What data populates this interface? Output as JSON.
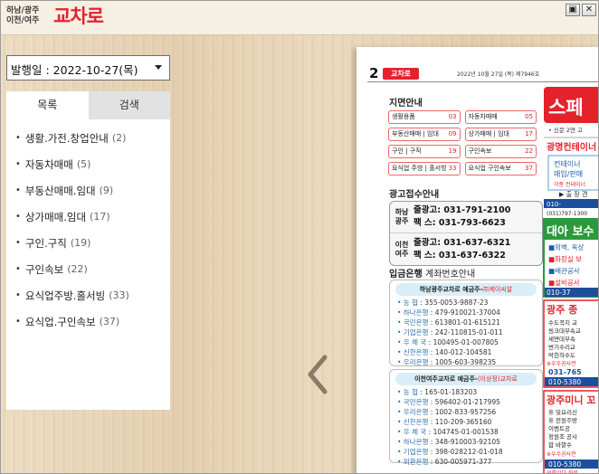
{
  "logo": {
    "region": "하남/광주\n이천/여주",
    "brand": "교차로"
  },
  "window": {
    "buttons": [
      "▣",
      "✕"
    ]
  },
  "date_select": {
    "label": "발행일 : 2022-10-27(목)"
  },
  "left_panel": {
    "tabs": [
      {
        "label": "목록"
      },
      {
        "label": "검색"
      }
    ],
    "categories": [
      {
        "name": "생활.가전.창업안내",
        "count": "(2)"
      },
      {
        "name": "자동차매매",
        "count": "(5)"
      },
      {
        "name": "부동산매매.임대",
        "count": "(9)"
      },
      {
        "name": "상가매매.임대",
        "count": "(17)"
      },
      {
        "name": "구인.구직",
        "count": "(19)"
      },
      {
        "name": "구인속보",
        "count": "(22)"
      },
      {
        "name": "요식업주방.홀서빙",
        "count": "(33)"
      },
      {
        "name": "요식업.구인속보",
        "count": "(37)"
      }
    ]
  },
  "paper": {
    "page_number": "2",
    "badge": "교차로",
    "issue_line": "2022년 10월 27일 (목) 제7946호",
    "toc_title": "지면안내",
    "toc": [
      [
        {
          "name": "생활용품",
          "page": "03"
        },
        {
          "name": "자동차매매",
          "page": "05"
        }
      ],
      [
        {
          "name": "부동산매매 | 임대",
          "page": "09"
        },
        {
          "name": "상가매매 | 임대",
          "page": "17"
        }
      ],
      [
        {
          "name": "구인 | 구직",
          "page": "19"
        },
        {
          "name": "구인속보",
          "page": "22"
        }
      ],
      [
        {
          "name": "요식업 주방 | 홀서빙",
          "page": "33"
        },
        {
          "name": "요식업 구인속보",
          "page": "37"
        }
      ]
    ],
    "ad_title": "광고접수안내",
    "ad_rows": [
      {
        "region": "하남\n광주",
        "line1": "줄광고: 031-791-2100",
        "line2": "팩 스: 031-793-6623"
      },
      {
        "region": "이천\n여주",
        "line1": "줄광고: 031-637-6321",
        "line2": "팩 스: 031-637-6322"
      }
    ],
    "bank_title": "입금은행",
    "bank_title_light": " 계좌번호안내",
    "bank_groups": [
      {
        "head": "하남광주교차로 예금주-",
        "holder": "㈜케이씨알",
        "lines": [
          {
            "bank": "농 협",
            "acct": ": 355-0053-9887-23"
          },
          {
            "bank": "하나은행",
            "acct": ": 479-910021-37004"
          },
          {
            "bank": "국민은행",
            "acct": ": 613801-01-615121"
          },
          {
            "bank": "기업은행",
            "acct": ": 242-110815-01-011"
          },
          {
            "bank": "우 체 국",
            "acct": ": 100495-01-007805"
          },
          {
            "bank": "신한은행",
            "acct": ": 140-012-104581"
          },
          {
            "bank": "우리은행",
            "acct": ": 1005-603-398235"
          }
        ]
      },
      {
        "head": "이천여주교차로 예금주-",
        "holder": "(이상정)교차로",
        "lines": [
          {
            "bank": "농 협",
            "acct": ": 165-01-183203"
          },
          {
            "bank": "국민은행",
            "acct": ": 596402-01-217995"
          },
          {
            "bank": "우리은행",
            "acct": ": 1002-833-957256"
          },
          {
            "bank": "신한은행",
            "acct": ": 110-209-365160"
          },
          {
            "bank": "우 체 국",
            "acct": ": 104745-01-001538"
          },
          {
            "bank": "하나은행",
            "acct": ": 348-910003-92105"
          },
          {
            "bank": "기업은행",
            "acct": ": 398-028212-01-018"
          },
          {
            "bank": "외환은행",
            "acct": ": 630-005971-377"
          }
        ]
      }
    ],
    "right_ads": {
      "a1": "스페",
      "a1_sub": "• 신문 2면 고",
      "a2": "광명컨테이너",
      "a2_items": [
        "컨테이너",
        "매입/판매",
        "각종 컨테이너"
      ],
      "a2_note": "▶ 출 장 견",
      "a2_phone": "010-",
      "a2_phone2": "(031)797-1300",
      "a3": "대아 보수",
      "a3_items": [
        "■외벽, 옥상",
        "■화장실 보",
        "■배관공사",
        "■설비공사"
      ],
      "a3_phone": "010-37",
      "a4": "광주 종",
      "a4_items": [
        "수도꼭지 교",
        "씽크대부속교",
        "세면대부속",
        "변기수리교",
        "막힌하수도"
      ],
      "a4_note": "※우수공사전",
      "a4_phone": "031-765",
      "a4_phone2": "010-5380",
      "a5": "광주미니 꼬",
      "a5_items": [
        "휴 및요리신",
        "휴 전원주방",
        "이벤트공",
        "정원조 공사",
        "합 바깥수"
      ],
      "a5_note": "※우수공사전",
      "a5_phone": "010-5380",
      "a6": "선룸있다 화류"
    }
  }
}
